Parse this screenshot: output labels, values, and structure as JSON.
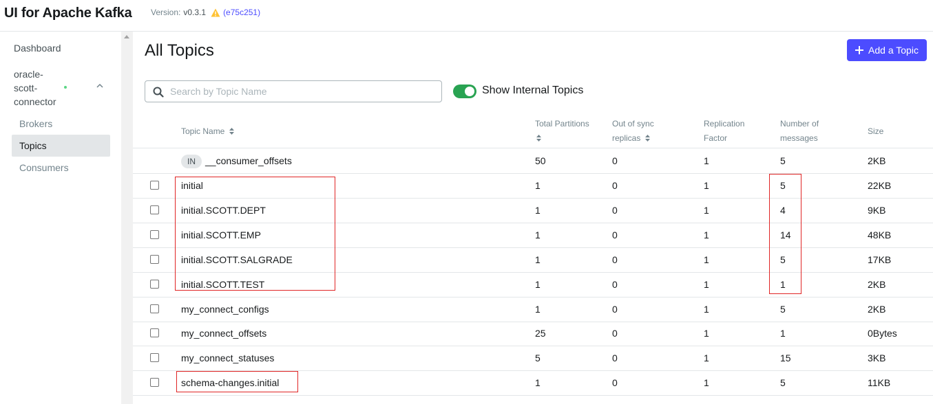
{
  "header": {
    "title": "UI for Apache Kafka",
    "version_label": "Version:",
    "version": "v0.3.1",
    "commit": "(e75c251)"
  },
  "sidebar": {
    "dashboard": "Dashboard",
    "cluster": "oracle-scott-connector",
    "cluster_status_color": "#5cd685",
    "items": [
      {
        "label": "Brokers"
      },
      {
        "label": "Topics",
        "active": true
      },
      {
        "label": "Consumers"
      }
    ]
  },
  "main": {
    "title": "All Topics",
    "add_button": "Add a Topic",
    "search_placeholder": "Search by Topic Name",
    "toggle_label": "Show Internal Topics",
    "toggle_on": true
  },
  "table": {
    "headers": {
      "name": "Topic Name",
      "partitions": "Total Partitions",
      "oos_line1": "Out of sync",
      "oos_line2": "replicas",
      "rep_line1": "Replication",
      "rep_line2": "Factor",
      "msg_line1": "Number of",
      "msg_line2": "messages",
      "size": "Size"
    },
    "internal_badge": "IN",
    "rows": [
      {
        "name": "__consumer_offsets",
        "partitions": "50",
        "oos": "0",
        "replication": "1",
        "messages": "5",
        "size": "2KB",
        "internal": true
      },
      {
        "name": "initial",
        "partitions": "1",
        "oos": "0",
        "replication": "1",
        "messages": "5",
        "size": "22KB"
      },
      {
        "name": "initial.SCOTT.DEPT",
        "partitions": "1",
        "oos": "0",
        "replication": "1",
        "messages": "4",
        "size": "9KB"
      },
      {
        "name": "initial.SCOTT.EMP",
        "partitions": "1",
        "oos": "0",
        "replication": "1",
        "messages": "14",
        "size": "48KB"
      },
      {
        "name": "initial.SCOTT.SALGRADE",
        "partitions": "1",
        "oos": "0",
        "replication": "1",
        "messages": "5",
        "size": "17KB"
      },
      {
        "name": "initial.SCOTT.TEST",
        "partitions": "1",
        "oos": "0",
        "replication": "1",
        "messages": "1",
        "size": "2KB"
      },
      {
        "name": "my_connect_configs",
        "partitions": "1",
        "oos": "0",
        "replication": "1",
        "messages": "5",
        "size": "2KB"
      },
      {
        "name": "my_connect_offsets",
        "partitions": "25",
        "oos": "0",
        "replication": "1",
        "messages": "1",
        "size": "0Bytes"
      },
      {
        "name": "my_connect_statuses",
        "partitions": "5",
        "oos": "0",
        "replication": "1",
        "messages": "15",
        "size": "3KB"
      },
      {
        "name": "schema-changes.initial",
        "partitions": "1",
        "oos": "0",
        "replication": "1",
        "messages": "5",
        "size": "11KB"
      }
    ]
  },
  "colors": {
    "accent": "#4c4cff",
    "toggle": "#29a352",
    "warning": "#ffc233",
    "annotation": "#e02424"
  }
}
